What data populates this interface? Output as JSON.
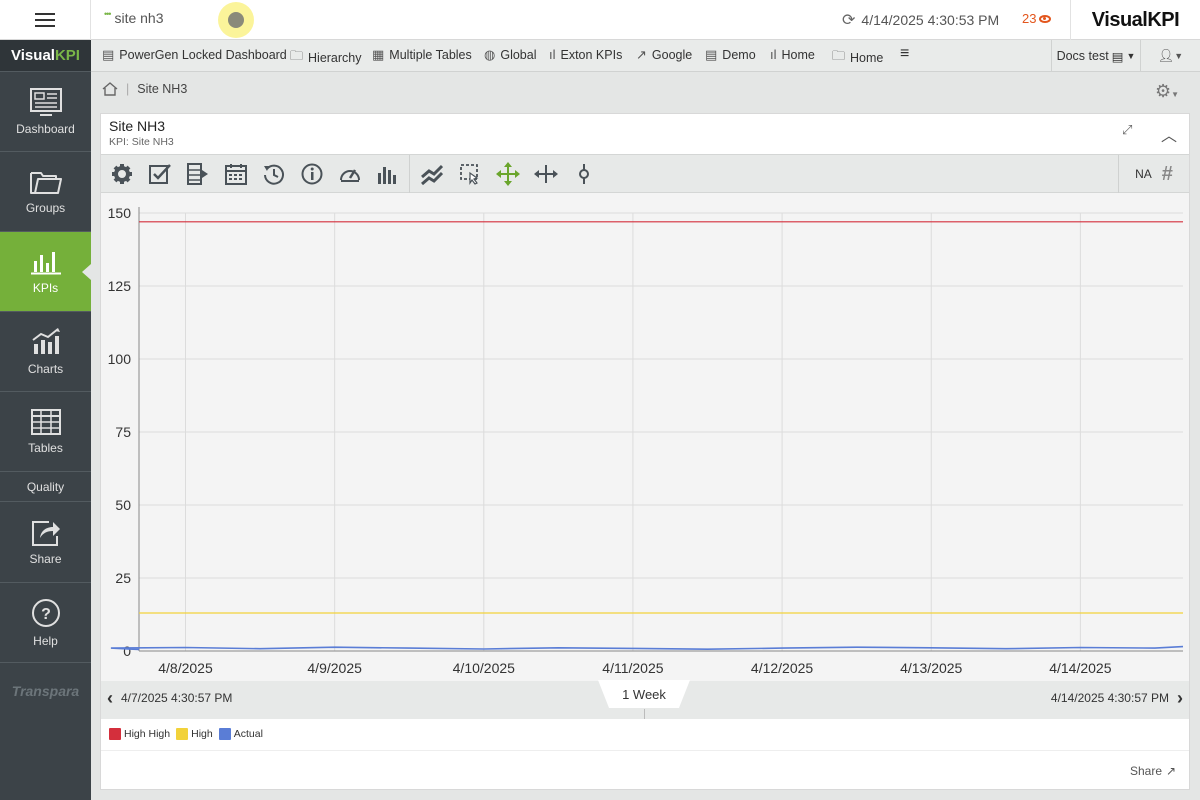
{
  "topbar": {
    "search_text": "site nh3",
    "timestamp": "4/14/2025 4:30:53 PM",
    "alert_count": "23",
    "brand": "VisualKPI"
  },
  "sidebar": {
    "logo_visual": "Visual",
    "logo_kpi": "KPI",
    "items": [
      {
        "label": "Dashboard",
        "icon": "dashboard-icon"
      },
      {
        "label": "Groups",
        "icon": "folder-icon"
      },
      {
        "label": "KPIs",
        "icon": "kpi-bars-icon",
        "active": true
      },
      {
        "label": "Charts",
        "icon": "chart-icon"
      },
      {
        "label": "Tables",
        "icon": "table-icon"
      },
      {
        "label": "Quality",
        "icon": ""
      },
      {
        "label": "Share",
        "icon": "share-icon"
      },
      {
        "label": "Help",
        "icon": "help-icon"
      }
    ],
    "footer_brand": "Transpara"
  },
  "favorites": [
    {
      "label": "PowerGen Locked Dashboard",
      "icon": "dashboard-icon"
    },
    {
      "label": "Hierarchy",
      "icon": "folder-icon"
    },
    {
      "label": "Multiple Tables",
      "icon": "table-icon"
    },
    {
      "label": "Global",
      "icon": "globe-icon"
    },
    {
      "label": "Exton KPIs",
      "icon": "kpi-bars-icon"
    },
    {
      "label": "Google",
      "icon": "external-link-icon"
    },
    {
      "label": "Demo",
      "icon": "dashboard-icon"
    },
    {
      "label": "Home",
      "icon": "kpi-bars-icon"
    },
    {
      "label": "Home",
      "icon": "folder-icon"
    }
  ],
  "profile": {
    "docs_label": "Docs test"
  },
  "breadcrumb": {
    "current": "Site NH3"
  },
  "card": {
    "title": "Site NH3",
    "subtitle": "KPI: Site NH3",
    "toolbar_na": "NA",
    "toolbar_hash": "#"
  },
  "time_range": {
    "start": "4/7/2025 4:30:57 PM",
    "end": "4/14/2025 4:30:57 PM",
    "range_label": "1 Week"
  },
  "share_label": "Share",
  "colors": {
    "accent_green": "#75b03a",
    "sidebar_bg": "#3c4348",
    "high_high": "#d42f3c",
    "high": "#f2d23a",
    "actual": "#5a7dd6",
    "alert_orange": "#e3561d"
  },
  "chart_data": {
    "type": "line",
    "title": "",
    "xlabel": "",
    "ylabel": "",
    "ylim": [
      0,
      150
    ],
    "yticks": [
      0,
      25,
      50,
      75,
      100,
      125,
      150
    ],
    "x_ticklabels": [
      "4/8/2025",
      "4/9/2025",
      "4/10/2025",
      "4/11/2025",
      "4/12/2025",
      "4/13/2025",
      "4/14/2025"
    ],
    "xlim": [
      "4/7/2025 4:30:57 PM",
      "4/14/2025 4:30:57 PM"
    ],
    "grid": true,
    "legend_position": "bottom-left",
    "series": [
      {
        "name": "High High",
        "color": "#d42f3c",
        "x": [
          "4/7/2025 4:30:57 PM",
          "4/14/2025 4:30:57 PM"
        ],
        "y": [
          147,
          147
        ]
      },
      {
        "name": "High",
        "color": "#f2d23a",
        "x": [
          "4/7/2025 4:30:57 PM",
          "4/14/2025 4:30:57 PM"
        ],
        "y": [
          13,
          13
        ]
      },
      {
        "name": "Actual",
        "color": "#5a7dd6",
        "x": [
          "4/7/2025 4:30:57 PM",
          "4/7/2025 12:00 PM",
          "4/8/2025 12:00 AM",
          "4/8/2025 12:00 PM",
          "4/9/2025 12:00 AM",
          "4/9/2025 12:00 PM",
          "4/10/2025 12:00 AM",
          "4/10/2025 12:00 PM",
          "4/11/2025 12:00 AM",
          "4/11/2025 12:00 PM",
          "4/12/2025 12:00 AM",
          "4/12/2025 12:00 PM",
          "4/13/2025 12:00 AM",
          "4/13/2025 12:00 PM",
          "4/14/2025 12:00 AM",
          "4/14/2025 12:00 PM",
          "4/14/2025 4:30:57 PM"
        ],
        "y": [
          0.5,
          1.0,
          1.2,
          0.8,
          1.3,
          1.0,
          0.7,
          1.1,
          0.9,
          0.6,
          1.0,
          1.3,
          1.1,
          0.8,
          1.2,
          1.0,
          1.5
        ]
      }
    ]
  }
}
